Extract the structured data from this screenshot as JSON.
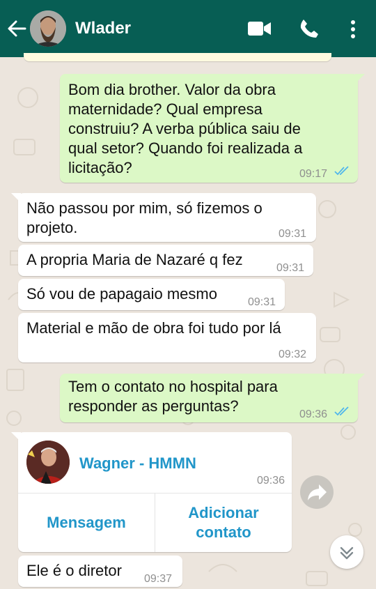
{
  "header": {
    "contact_name": "Wlader",
    "icons": [
      "back-arrow-icon",
      "video-call-icon",
      "phone-call-icon",
      "more-options-icon"
    ],
    "color": "#075e54"
  },
  "messages": [
    {
      "direction": "out",
      "lines": [
        "Bom dia brother. Valor da obra",
        "maternidade? Qual empresa",
        "construiu? A verba pública saiu de",
        "qual setor? Quando foi realizada a",
        "licitação?"
      ],
      "time": "09:17",
      "read": true
    },
    {
      "direction": "in",
      "lines": [
        "Não passou por mim, só fizemos o",
        "projeto."
      ],
      "time": "09:31"
    },
    {
      "direction": "in",
      "lines": [
        "A propria Maria de Nazaré q fez"
      ],
      "time": "09:31"
    },
    {
      "direction": "in",
      "lines": [
        "Só vou de papagaio mesmo"
      ],
      "time": "09:31"
    },
    {
      "direction": "in",
      "lines": [
        "Material e mão de obra foi tudo por lá"
      ],
      "time": "09:32"
    },
    {
      "direction": "out",
      "lines": [
        "Tem o contato no hospital para",
        "responder as perguntas?"
      ],
      "time": "09:36",
      "read": true
    },
    {
      "direction": "in",
      "lines": [
        "Ele é o diretor"
      ],
      "time": "09:37"
    }
  ],
  "contact_card": {
    "name": "Wagner - HMMN",
    "time": "09:36",
    "message_label": "Mensagem",
    "add_label_line1": "Adicionar",
    "add_label_line2": "contato"
  },
  "colors": {
    "outgoing": "#dcf8c6",
    "incoming": "#ffffff",
    "link": "#2196c9",
    "read_ticks": "#4fb6ec"
  }
}
